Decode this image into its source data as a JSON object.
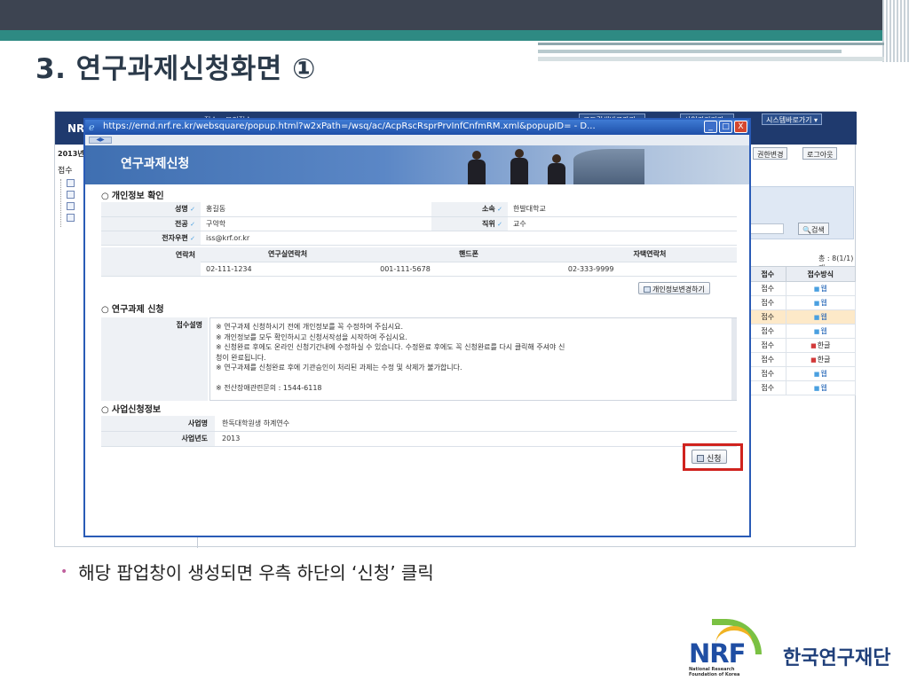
{
  "slide": {
    "title": "3. 연구과제신청화면 ①",
    "bullet": "해당 팝업창이 생성되면 우측 하단의 ‘신청’ 클릭"
  },
  "background_app": {
    "logo": "NR",
    "top_menu": [
      "접수",
      "모의접수"
    ],
    "top_buttons": [
      "코드검색바로가기 ▾",
      "사업관리기관 ▾",
      "시스템바로가기 ▾"
    ],
    "year_label": "2013년",
    "sidebar_label": "접수",
    "buttons": {
      "perm_change": "권한변경",
      "logout": "로그아웃",
      "search": "검색"
    },
    "total_text": "총 : 8(1/1)개",
    "table": {
      "headers": [
        "접수",
        "접수방식"
      ],
      "rows": [
        {
          "status": "접수",
          "method": "웹",
          "kind": "web"
        },
        {
          "status": "접수",
          "method": "웹",
          "kind": "web"
        },
        {
          "status": "접수",
          "method": "웹",
          "kind": "web"
        },
        {
          "status": "접수",
          "method": "웹",
          "kind": "web"
        },
        {
          "status": "접수",
          "method": "한글",
          "kind": "hangul"
        },
        {
          "status": "접수",
          "method": "한글",
          "kind": "hangul"
        },
        {
          "status": "접수",
          "method": "웹",
          "kind": "web"
        },
        {
          "status": "접수",
          "method": "웹",
          "kind": "web"
        }
      ],
      "highlight_row_index": 2
    }
  },
  "popup": {
    "window_title": "https://ernd.nrf.re.kr/websquare/popup.html?w2xPath=/wsq/ac/AcpRscRsprPrvInfCnfmRM.xml&popupID= - D...",
    "window_buttons": [
      "_",
      "□",
      "X"
    ],
    "banner_title": "연구과제신청",
    "personal_section": {
      "title": "개인정보 확인",
      "name_label": "성명",
      "name": "홍길동",
      "affiliation_label": "소속",
      "affiliation": "한발대학교",
      "major_label": "전공",
      "major": "구약학",
      "position_label": "직위",
      "position": "교수",
      "email_label": "전자우편",
      "email": "iss@krf.or.kr",
      "contact_label": "연락처",
      "contact_headers": [
        "연구실연락처",
        "핸드폰",
        "자택연락처"
      ],
      "contact_values": [
        "02-111-1234",
        "001-111-5678",
        "02-333-9999"
      ],
      "edit_button": "개인정보변경하기"
    },
    "application_section": {
      "title": "연구과제 신청",
      "notice_label": "접수설명",
      "notice_lines": [
        "※ 연구과제 신청하시기 전에 개인정보를 꼭 수정하여 주십시요.",
        "※ 개인정보를 모두 확인하시고 신청서작성을 시작하여 주십시요.",
        "※ 신청완료 후에도 온라인 신청기간내에 수정하실 수 있습니다. 수정완료 후에도 꼭 신청완료를 다시 클릭해 주셔야 신",
        "청이 완료됩니다.",
        "※ 연구과제를 신청완료 후에 기관승인이 처리된 과제는 수정 및 삭제가 불가합니다.",
        "",
        "※ 전산장애관련문의 : 1544-6118"
      ]
    },
    "business_section": {
      "title": "사업신청정보",
      "biz_name_label": "사업명",
      "biz_name": "한독대학원생 하계연수",
      "biz_year_label": "사업년도",
      "biz_year": "2013"
    },
    "apply_button": "신청"
  },
  "footer": {
    "logo_mark": "NRF",
    "logo_sub": [
      "National Research",
      "Foundation of Korea"
    ],
    "logo_korean": "한국연구재단"
  },
  "colors": {
    "top_band": "#3d4451",
    "teal_band": "#2e8a83",
    "popup_border": "#2a5bb6",
    "highlight_red": "#d0231e",
    "nrf_blue": "#1f4ea3",
    "nrf_green": "#7ac143"
  }
}
